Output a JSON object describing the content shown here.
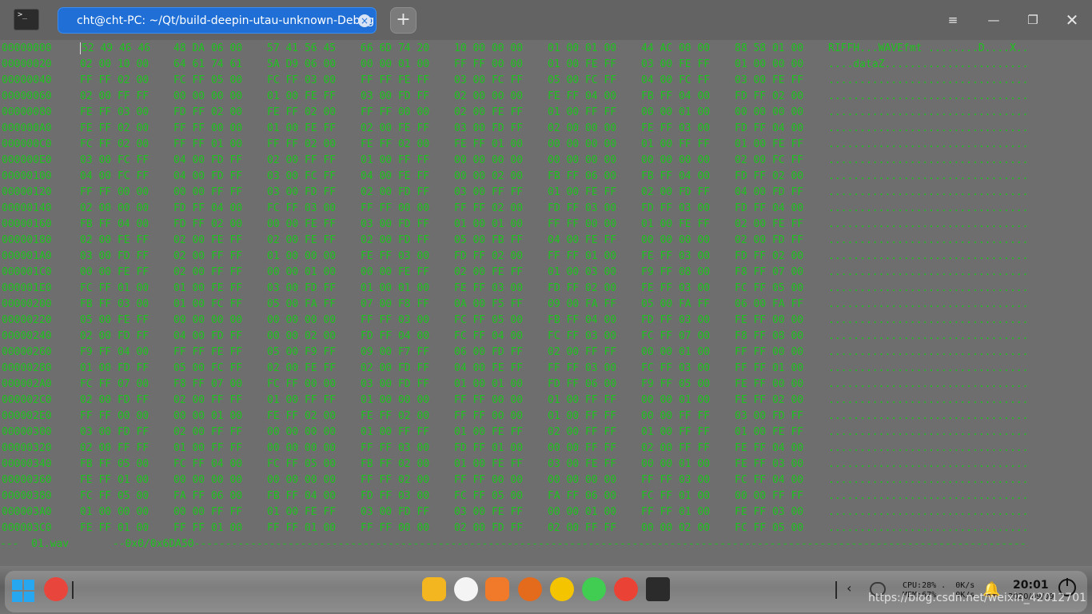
{
  "titlebar": {
    "app_icon_glyph": ">_",
    "tab_title": "cht@cht-PC: ~/Qt/build-deepin-utau-unknown-Debug",
    "tab_close_glyph": "×",
    "new_tab_glyph": "+",
    "menu_glyph": "≡",
    "minimize_glyph": "—",
    "maximize_glyph": "❐",
    "close_glyph": "✕"
  },
  "hexdump": {
    "rows": [
      {
        "offset": "00000000",
        "groups": [
          "52 49 46 46",
          "48 DA 06 00",
          "57 41 56 45",
          "66 6D 74 20",
          "10 00 00 00",
          "01 00 01 00",
          "44 AC 00 00",
          "88 58 01 00"
        ],
        "ascii": "RIFFH...WAVEfmt ........D....X.."
      },
      {
        "offset": "00000020",
        "groups": [
          "02 00 10 00",
          "64 61 74 61",
          "5A D9 06 00",
          "00 00 01 00",
          "FF FF 00 00",
          "01 00 FE FF",
          "03 00 FE FF",
          "01 00 00 00"
        ],
        "ascii": "....dataZ......................."
      },
      {
        "offset": "00000040",
        "groups": [
          "FF FF 02 00",
          "FC FF 05 00",
          "FC FF 03 00",
          "FF FF FE FF",
          "03 00 FC FF",
          "05 00 FC FF",
          "04 00 FC FF",
          "03 00 FE FF"
        ],
        "ascii": "................................"
      },
      {
        "offset": "00000060",
        "groups": [
          "02 00 FF FF",
          "00 00 00 00",
          "01 00 FE FF",
          "03 00 FD FF",
          "02 00 00 00",
          "FE FF 04 00",
          "FB FF 04 00",
          "FD FF 02 00"
        ],
        "ascii": "................................"
      },
      {
        "offset": "00000080",
        "groups": [
          "FE FF 03 00",
          "FD FF 02 00",
          "FE FF 02 00",
          "FF FF 00 00",
          "02 00 FE FF",
          "01 00 FF FF",
          "00 00 01 00",
          "00 00 00 00"
        ],
        "ascii": "................................"
      },
      {
        "offset": "000000A0",
        "groups": [
          "FE FF 02 00",
          "FF FF 00 00",
          "01 00 FE FF",
          "02 00 FE FF",
          "03 00 FD FF",
          "02 00 00 00",
          "FE FF 03 00",
          "FD FF 04 00"
        ],
        "ascii": "................................"
      },
      {
        "offset": "000000C0",
        "groups": [
          "FC FF 02 00",
          "FF FF 01 00",
          "FF FF 02 00",
          "FE FF 02 00",
          "FE FF 01 00",
          "00 00 00 00",
          "01 00 FF FF",
          "01 00 FE FF"
        ],
        "ascii": "................................"
      },
      {
        "offset": "000000E0",
        "groups": [
          "03 00 FC FF",
          "04 00 FD FF",
          "02 00 FF FF",
          "01 00 FF FF",
          "00 00 00 00",
          "00 00 00 00",
          "00 00 00 00",
          "02 00 FC FF"
        ],
        "ascii": "................................"
      },
      {
        "offset": "00000100",
        "groups": [
          "04 00 FC FF",
          "04 00 FD FF",
          "03 00 FC FF",
          "04 00 FE FF",
          "00 00 02 00",
          "FB FF 06 00",
          "FB FF 04 00",
          "FD FF 02 00"
        ],
        "ascii": "................................"
      },
      {
        "offset": "00000120",
        "groups": [
          "FF FF 00 00",
          "00 00 FF FF",
          "03 00 FD FF",
          "02 00 FD FF",
          "03 00 FF FF",
          "01 00 FE FF",
          "02 00 FD FF",
          "04 00 FD FF"
        ],
        "ascii": "................................"
      },
      {
        "offset": "00000140",
        "groups": [
          "02 00 00 00",
          "FD FF 04 00",
          "FC FF 03 00",
          "FF FF 00 00",
          "FF FF 02 00",
          "FD FF 03 00",
          "FD FF 03 00",
          "FD FF 04 00"
        ],
        "ascii": "................................"
      },
      {
        "offset": "00000160",
        "groups": [
          "FB FF 04 00",
          "FD FF 02 00",
          "00 00 FE FF",
          "03 00 FD FF",
          "01 00 01 00",
          "FF FF 00 00",
          "01 00 FE FF",
          "02 00 FE FF"
        ],
        "ascii": "................................"
      },
      {
        "offset": "00000180",
        "groups": [
          "02 00 FE FF",
          "02 00 FE FF",
          "02 00 FE FF",
          "02 00 FD FF",
          "05 00 FB FF",
          "04 00 FE FF",
          "00 00 00 00",
          "02 00 FD FF"
        ],
        "ascii": "................................"
      },
      {
        "offset": "000001A0",
        "groups": [
          "03 00 FD FF",
          "02 00 FF FF",
          "01 00 00 00",
          "FE FF 03 00",
          "FD FF 02 00",
          "FF FF 01 00",
          "FE FF 03 00",
          "FD FF 02 00"
        ],
        "ascii": "................................"
      },
      {
        "offset": "000001C0",
        "groups": [
          "00 00 FE FF",
          "02 00 FF FF",
          "00 00 01 00",
          "00 00 FE FF",
          "02 00 FE FF",
          "01 00 03 00",
          "F9 FF 08 00",
          "F8 FF 07 00"
        ],
        "ascii": "................................"
      },
      {
        "offset": "000001E0",
        "groups": [
          "FC FF 01 00",
          "01 00 FE FF",
          "03 00 FD FF",
          "01 00 01 00",
          "FE FF 03 00",
          "FD FF 02 00",
          "FE FF 03 00",
          "FC FF 05 00"
        ],
        "ascii": "................................"
      },
      {
        "offset": "00000200",
        "groups": [
          "FB FF 03 00",
          "01 00 FC FF",
          "05 00 FA FF",
          "07 00 F8 FF",
          "0A 00 F5 FF",
          "09 00 FA FF",
          "05 00 FA FF",
          "06 00 FA FF"
        ],
        "ascii": "................................"
      },
      {
        "offset": "00000220",
        "groups": [
          "05 00 FE FF",
          "00 00 00 00",
          "00 00 00 00",
          "FF FF 03 00",
          "FC FF 05 00",
          "FB FF 04 00",
          "FD FF 03 00",
          "FE FF 00 00"
        ],
        "ascii": "................................"
      },
      {
        "offset": "00000240",
        "groups": [
          "02 00 FD FF",
          "04 00 FD FF",
          "00 00 02 00",
          "FD FF 04 00",
          "FC FF 04 00",
          "FC FF 03 00",
          "FC FF 07 00",
          "F8 FF 08 00"
        ],
        "ascii": "................................"
      },
      {
        "offset": "00000260",
        "groups": [
          "F9 FF 04 00",
          "FF FF FE FF",
          "05 00 F9 FF",
          "09 00 F7 FF",
          "06 00 FD FF",
          "02 00 FF FF",
          "00 00 01 00",
          "FF FF 00 00"
        ],
        "ascii": "................................"
      },
      {
        "offset": "00000280",
        "groups": [
          "01 00 FD FF",
          "05 00 FC FF",
          "02 00 FE FF",
          "02 00 FD FF",
          "04 00 FE FF",
          "FF FF 03 00",
          "FC FF 03 00",
          "FF FF 01 00"
        ],
        "ascii": "................................"
      },
      {
        "offset": "000002A0",
        "groups": [
          "FC FF 07 00",
          "F8 FF 07 00",
          "FC FF 00 00",
          "03 00 FD FF",
          "01 00 01 00",
          "FD FF 06 00",
          "F9 FF 05 00",
          "FE FF 00 00"
        ],
        "ascii": "................................"
      },
      {
        "offset": "000002C0",
        "groups": [
          "02 00 FD FF",
          "02 00 FF FF",
          "01 00 FF FF",
          "01 00 00 00",
          "FF FF 00 00",
          "01 00 FF FF",
          "00 00 01 00",
          "FE FF 02 00"
        ],
        "ascii": "................................"
      },
      {
        "offset": "000002E0",
        "groups": [
          "FF FF 00 00",
          "00 00 01 00",
          "FE FF 02 00",
          "FE FF 02 00",
          "FF FF 00 00",
          "01 00 FF FF",
          "00 00 FF FF",
          "03 00 FD FF"
        ],
        "ascii": "................................"
      },
      {
        "offset": "00000300",
        "groups": [
          "03 00 FD FF",
          "02 00 FF FF",
          "00 00 00 00",
          "01 00 FF FF",
          "01 00 FE FF",
          "02 00 FF FF",
          "01 00 FF FF",
          "01 00 FE FF"
        ],
        "ascii": "................................"
      },
      {
        "offset": "00000320",
        "groups": [
          "02 00 FF FF",
          "01 00 FF FF",
          "00 00 00 00",
          "FF FF 03 00",
          "FD FF 01 00",
          "00 00 FF FF",
          "02 00 FF FF",
          "FE FF 04 00"
        ],
        "ascii": "................................"
      },
      {
        "offset": "00000340",
        "groups": [
          "FB FF 05 00",
          "FC FF 04 00",
          "FC FF 05 00",
          "FB FF 02 00",
          "01 00 FE FF",
          "03 00 FE FF",
          "00 00 01 00",
          "FE FF 03 00"
        ],
        "ascii": "................................"
      },
      {
        "offset": "00000360",
        "groups": [
          "FE FF 01 00",
          "00 00 00 00",
          "00 00 00 00",
          "FF FF 02 00",
          "FF FF 00 00",
          "00 00 00 00",
          "FF FF 03 00",
          "FC FF 04 00"
        ],
        "ascii": "................................"
      },
      {
        "offset": "00000380",
        "groups": [
          "FC FF 05 00",
          "FA FF 06 00",
          "FB FF 04 00",
          "FD FF 03 00",
          "FC FF 05 00",
          "FA FF 06 00",
          "FC FF 01 00",
          "00 00 FF FF"
        ],
        "ascii": "................................"
      },
      {
        "offset": "000003A0",
        "groups": [
          "01 00 00 00",
          "00 00 FF FF",
          "01 00 FE FF",
          "03 00 FD FF",
          "03 00 FE FF",
          "00 00 01 00",
          "FF FF 01 00",
          "FE FF 03 00"
        ],
        "ascii": "................................"
      },
      {
        "offset": "000003C0",
        "groups": [
          "FE FF 01 00",
          "FF FF 01 00",
          "FF FF 01 00",
          "FF FF 00 00",
          "02 00 FD FF",
          "02 00 FF FF",
          "00 00 02 00",
          "FC FF 05 00"
        ],
        "ascii": "................................"
      }
    ],
    "status_line": "---  01.wav       --0x0/0x6DA50-------------------------------------------------------------------------------------------------------------------------------------"
  },
  "dock": {
    "sysmon": "CPU:28% .  0K/s\nMEM:67%    0K/s",
    "clock_time": "20:01",
    "clock_date": "2020/09/09",
    "watermark": "https://blog.csdn.net/weixin_42012701",
    "colors": {
      "launcher_red": "#e8463c",
      "files_yellow": "#f3b520",
      "music_white": "#f4f4f4",
      "video_orange": "#f07a2a",
      "settings_orange": "#e46a1c",
      "recorder_yellow": "#f5c400",
      "qt_green": "#41cd52",
      "terminal_dark": "#2b2b2b"
    }
  }
}
